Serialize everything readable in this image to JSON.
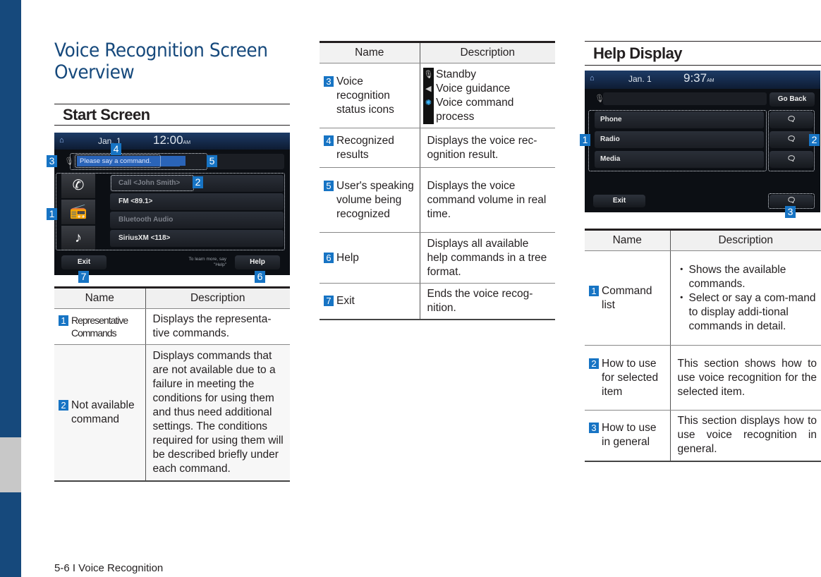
{
  "page": {
    "title": "Voice Recognition Screen Overview",
    "footer": "5-6 I Voice Recognition",
    "accent_color": "#16497c",
    "callout_color": "#1774c4"
  },
  "start_screen": {
    "heading": "Start Screen",
    "screenshot": {
      "date": "Jan. 1",
      "time": "12:00",
      "ampm": "AM",
      "prompt": "Please say a command.",
      "commands": [
        {
          "label": "Call <John Smith>",
          "available": false,
          "icon": "phone-icon"
        },
        {
          "label": "FM <89.1>",
          "available": true,
          "icon": "radio-icon"
        },
        {
          "label": "Bluetooth Audio",
          "available": false,
          "icon": "music-icon"
        },
        {
          "label": "SiriusXM <118>",
          "available": true,
          "icon": ""
        }
      ],
      "exit_label": "Exit",
      "help_label": "Help",
      "hint": "To learn more, say \"Help\"",
      "callouts": [
        "1",
        "2",
        "3",
        "4",
        "5",
        "6",
        "7"
      ]
    },
    "table": {
      "headers": [
        "Name",
        "Description"
      ],
      "rows": [
        {
          "num": "1",
          "name": "Representative Commands",
          "desc": "Displays the representa-tive commands."
        },
        {
          "num": "2",
          "name": "Not available command",
          "desc": "Displays commands that are not available due to a failure in meeting the conditions for using them and thus need additional settings. The conditions required for using them will be described briefly under each command."
        }
      ]
    }
  },
  "middle_table": {
    "headers": [
      "Name",
      "Description"
    ],
    "rows": [
      {
        "num": "3",
        "name": "Voice recognition status icons",
        "status_items": [
          "Standby",
          "Voice guidance",
          "Voice command process"
        ]
      },
      {
        "num": "4",
        "name": "Recognized results",
        "desc": "Displays the voice rec-ognition result."
      },
      {
        "num": "5",
        "name": "User's speaking volume being recognized",
        "desc": "Displays the voice command volume in real time."
      },
      {
        "num": "6",
        "name": "Help",
        "desc": "Displays all available help commands in a tree format."
      },
      {
        "num": "7",
        "name": "Exit",
        "desc": "Ends the voice recog-nition."
      }
    ]
  },
  "help_display": {
    "heading": "Help Display",
    "screenshot": {
      "date": "Jan. 1",
      "time": "9:37",
      "ampm": "AM",
      "go_back_label": "Go Back",
      "commands": [
        "Phone",
        "Radio",
        "Media"
      ],
      "exit_label": "Exit",
      "callouts": [
        "1",
        "2",
        "3"
      ]
    },
    "table": {
      "headers": [
        "Name",
        "Description"
      ],
      "rows": [
        {
          "num": "1",
          "name": "Command list",
          "bullets": [
            "Shows the available commands.",
            "Select or say a com-mand to display addi-tional commands in detail."
          ]
        },
        {
          "num": "2",
          "name": "How to use for selected item",
          "desc": "This section shows how to use voice recognition for the selected item."
        },
        {
          "num": "3",
          "name": "How to use in general",
          "desc": "This section displays how to use voice recognition in general."
        }
      ]
    }
  }
}
